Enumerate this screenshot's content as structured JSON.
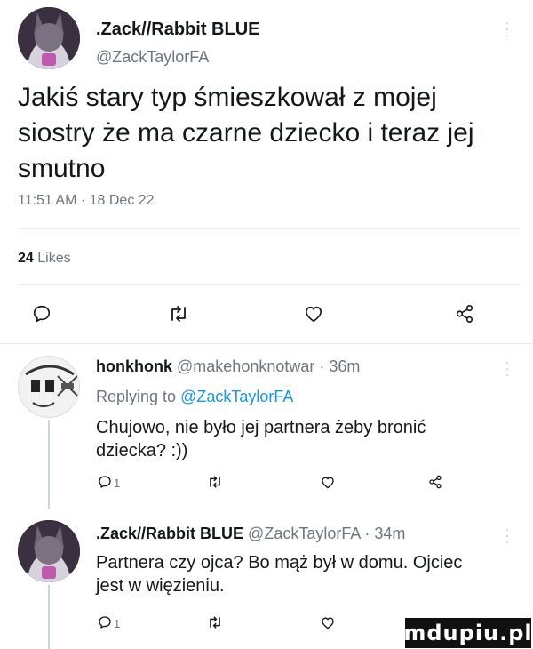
{
  "main_tweet": {
    "name": ".Zack//Rabbit BLUE",
    "handle": "@ZackTaylorFA",
    "text": "Jakiś stary typ śmieszkował z mojej siostry że ma czarne dziecko i teraz jej smutno",
    "timestamp": "11:51 AM · 18 Dec 22",
    "likes_count": "24",
    "likes_label": "Likes"
  },
  "reply1": {
    "name": "honkhonk",
    "handle": "@makehonknotwar",
    "time": "· 36m",
    "replying_prefix": "Replying to",
    "replying_handle": "@ZackTaylorFA",
    "text": "Chujowo, nie było jej partnera żeby bronić dziecka? :))",
    "reply_count": "1"
  },
  "reply2": {
    "name": ".Zack//Rabbit BLUE",
    "handle": "@ZackTaylorFA",
    "time": "· 34m",
    "text": "Partnera czy ojca? Bo mąż był w domu. Ojciec jest w więzieniu.",
    "reply_count": "1"
  },
  "watermark": "mdupiu.pl",
  "colors": {
    "text": "#14171a",
    "secondary": "#6e767d",
    "link": "#1b95e0",
    "divider": "#e6ecf0"
  },
  "icons": [
    "reply-icon",
    "retweet-icon",
    "heart-icon",
    "share-icon",
    "more-icon"
  ]
}
